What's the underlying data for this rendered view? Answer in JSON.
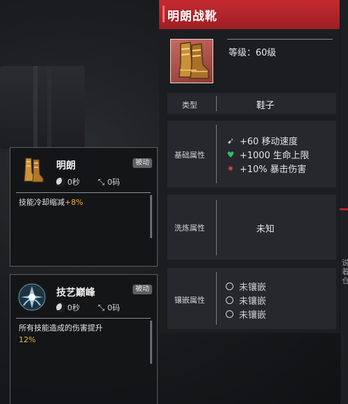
{
  "item": {
    "title": "明朗战靴",
    "level": "等级：60级",
    "type_label": "类型",
    "type_value": "鞋子",
    "base_label": "基础属性",
    "base_attrs": [
      {
        "text": "+60 移动速度",
        "icon": "boot-speed-icon",
        "color": "#d9d9d9"
      },
      {
        "text": "+1000 生命上限",
        "icon": "heart-icon",
        "color": "#2fc06a"
      },
      {
        "text": "+10% 暴击伤害",
        "icon": "crit-damage-icon",
        "color": "#e0463f"
      }
    ],
    "refine_label": "洗炼属性",
    "refine_value": "未知",
    "socket_label": "镶嵌属性",
    "sockets": [
      "未镶嵌",
      "未镶嵌",
      "未镶嵌"
    ],
    "header_color": "#c42a30"
  },
  "cards": [
    {
      "name": "明朗",
      "badge": "被动",
      "cooldown": "0秒",
      "range": "0码",
      "desc_prefix": "技能冷却缩减",
      "desc_highlight": "+8%",
      "desc_suffix": ""
    },
    {
      "name": "技艺巅峰",
      "badge": "被动",
      "cooldown": "0秒",
      "range": "0码",
      "desc_prefix": "所有技能造成的伤害提升",
      "desc_highlight": "12%",
      "desc_suffix": ""
    }
  ],
  "background": {
    "side_text": "说着仓"
  }
}
